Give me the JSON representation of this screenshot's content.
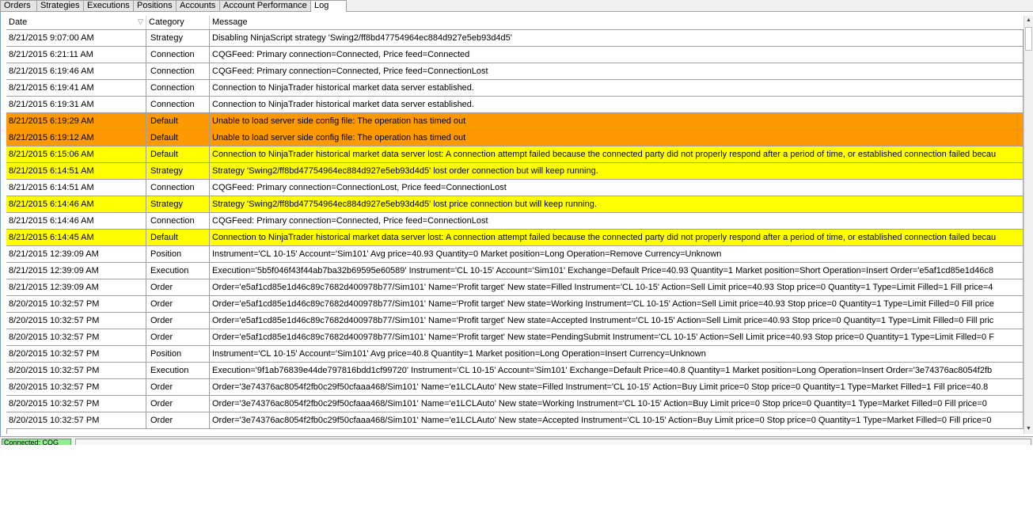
{
  "tabs": [
    {
      "label": "Orders"
    },
    {
      "label": "Strategies"
    },
    {
      "label": "Executions"
    },
    {
      "label": "Positions"
    },
    {
      "label": "Accounts"
    },
    {
      "label": "Account Performance"
    },
    {
      "label": "Log",
      "active": true
    }
  ],
  "columns": {
    "date": "Date",
    "category": "Category",
    "message": "Message"
  },
  "colors": {
    "default_row": "#ffffff",
    "orange": "#ff9900",
    "yellow": "#ffff00",
    "status_connected": "#90ee90"
  },
  "rows": [
    {
      "date": "8/21/2015 9:07:00 AM",
      "category": "Strategy",
      "message": "Disabling NinjaScript strategy 'Swing2/ff8bd47754964ec884d927e5eb93d4d5'",
      "color": "#ffffff"
    },
    {
      "date": "8/21/2015 6:21:11 AM",
      "category": "Connection",
      "message": "CQGFeed: Primary connection=Connected, Price feed=Connected",
      "color": "#ffffff"
    },
    {
      "date": "8/21/2015 6:19:46 AM",
      "category": "Connection",
      "message": "CQGFeed: Primary connection=Connected, Price feed=ConnectionLost",
      "color": "#ffffff"
    },
    {
      "date": "8/21/2015 6:19:41 AM",
      "category": "Connection",
      "message": "Connection to NinjaTrader historical market data server established.",
      "color": "#ffffff"
    },
    {
      "date": "8/21/2015 6:19:31 AM",
      "category": "Connection",
      "message": "Connection to NinjaTrader historical market data server established.",
      "color": "#ffffff"
    },
    {
      "date": "8/21/2015 6:19:29 AM",
      "category": "Default",
      "message": "Unable to load server side config file: The operation has timed out",
      "color": "#ff9900"
    },
    {
      "date": "8/21/2015 6:19:12 AM",
      "category": "Default",
      "message": "Unable to load server side config file: The operation has timed out",
      "color": "#ff9900"
    },
    {
      "date": "8/21/2015 6:15:06 AM",
      "category": "Default",
      "message": "Connection to NinjaTrader historical market data server lost: A connection attempt failed because the connected party did not properly respond after a period of time, or established connection failed becau",
      "color": "#ffff00"
    },
    {
      "date": "8/21/2015 6:14:51 AM",
      "category": "Strategy",
      "message": "Strategy 'Swing2/ff8bd47754964ec884d927e5eb93d4d5' lost order connection but will keep running.",
      "color": "#ffff00"
    },
    {
      "date": "8/21/2015 6:14:51 AM",
      "category": "Connection",
      "message": "CQGFeed: Primary connection=ConnectionLost, Price feed=ConnectionLost",
      "color": "#ffffff"
    },
    {
      "date": "8/21/2015 6:14:46 AM",
      "category": "Strategy",
      "message": "Strategy 'Swing2/ff8bd47754964ec884d927e5eb93d4d5' lost price connection but will keep running.",
      "color": "#ffff00"
    },
    {
      "date": "8/21/2015 6:14:46 AM",
      "category": "Connection",
      "message": "CQGFeed: Primary connection=Connected, Price feed=ConnectionLost",
      "color": "#ffffff"
    },
    {
      "date": "8/21/2015 6:14:45 AM",
      "category": "Default",
      "message": "Connection to NinjaTrader historical market data server lost: A connection attempt failed because the connected party did not properly respond after a period of time, or established connection failed becau",
      "color": "#ffff00"
    },
    {
      "date": "8/21/2015 12:39:09 AM",
      "category": "Position",
      "message": "Instrument='CL 10-15' Account='Sim101' Avg price=40.93 Quantity=0 Market position=Long Operation=Remove Currency=Unknown",
      "color": "#ffffff"
    },
    {
      "date": "8/21/2015 12:39:09 AM",
      "category": "Execution",
      "message": "Execution='5b5f046f43f44ab7ba32b69595e60589' Instrument='CL 10-15' Account='Sim101' Exchange=Default Price=40.93 Quantity=1 Market position=Short Operation=Insert Order='e5af1cd85e1d46c8",
      "color": "#ffffff"
    },
    {
      "date": "8/21/2015 12:39:09 AM",
      "category": "Order",
      "message": "Order='e5af1cd85e1d46c89c7682d400978b77/Sim101' Name='Profit target' New state=Filled Instrument='CL 10-15' Action=Sell Limit price=40.93 Stop price=0 Quantity=1 Type=Limit Filled=1 Fill price=4",
      "color": "#ffffff"
    },
    {
      "date": "8/20/2015 10:32:57 PM",
      "category": "Order",
      "message": "Order='e5af1cd85e1d46c89c7682d400978b77/Sim101' Name='Profit target' New state=Working Instrument='CL 10-15' Action=Sell Limit price=40.93 Stop price=0 Quantity=1 Type=Limit Filled=0 Fill price",
      "color": "#ffffff"
    },
    {
      "date": "8/20/2015 10:32:57 PM",
      "category": "Order",
      "message": "Order='e5af1cd85e1d46c89c7682d400978b77/Sim101' Name='Profit target' New state=Accepted Instrument='CL 10-15' Action=Sell Limit price=40.93 Stop price=0 Quantity=1 Type=Limit Filled=0 Fill pric",
      "color": "#ffffff"
    },
    {
      "date": "8/20/2015 10:32:57 PM",
      "category": "Order",
      "message": "Order='e5af1cd85e1d46c89c7682d400978b77/Sim101' Name='Profit target' New state=PendingSubmit Instrument='CL 10-15' Action=Sell Limit price=40.93 Stop price=0 Quantity=1 Type=Limit Filled=0 F",
      "color": "#ffffff"
    },
    {
      "date": "8/20/2015 10:32:57 PM",
      "category": "Position",
      "message": "Instrument='CL 10-15' Account='Sim101' Avg price=40.8 Quantity=1 Market position=Long Operation=Insert Currency=Unknown",
      "color": "#ffffff"
    },
    {
      "date": "8/20/2015 10:32:57 PM",
      "category": "Execution",
      "message": "Execution='9f1ab76839e44de797816bdd1cf99720' Instrument='CL 10-15' Account='Sim101' Exchange=Default Price=40.8 Quantity=1 Market position=Long Operation=Insert Order='3e74376ac8054f2fb",
      "color": "#ffffff"
    },
    {
      "date": "8/20/2015 10:32:57 PM",
      "category": "Order",
      "message": "Order='3e74376ac8054f2fb0c29f50cfaaa468/Sim101' Name='e1LCLAuto' New state=Filled Instrument='CL 10-15' Action=Buy Limit price=0 Stop price=0 Quantity=1 Type=Market Filled=1 Fill price=40.8",
      "color": "#ffffff"
    },
    {
      "date": "8/20/2015 10:32:57 PM",
      "category": "Order",
      "message": "Order='3e74376ac8054f2fb0c29f50cfaaa468/Sim101' Name='e1LCLAuto' New state=Working Instrument='CL 10-15' Action=Buy Limit price=0 Stop price=0 Quantity=1 Type=Market Filled=0 Fill price=0",
      "color": "#ffffff"
    },
    {
      "date": "8/20/2015 10:32:57 PM",
      "category": "Order",
      "message": "Order='3e74376ac8054f2fb0c29f50cfaaa468/Sim101' Name='e1LCLAuto' New state=Accepted Instrument='CL 10-15' Action=Buy Limit price=0 Stop price=0 Quantity=1 Type=Market Filled=0 Fill price=0",
      "color": "#ffffff"
    }
  ],
  "statusbar": {
    "connection_label": "Connected: CQG"
  }
}
